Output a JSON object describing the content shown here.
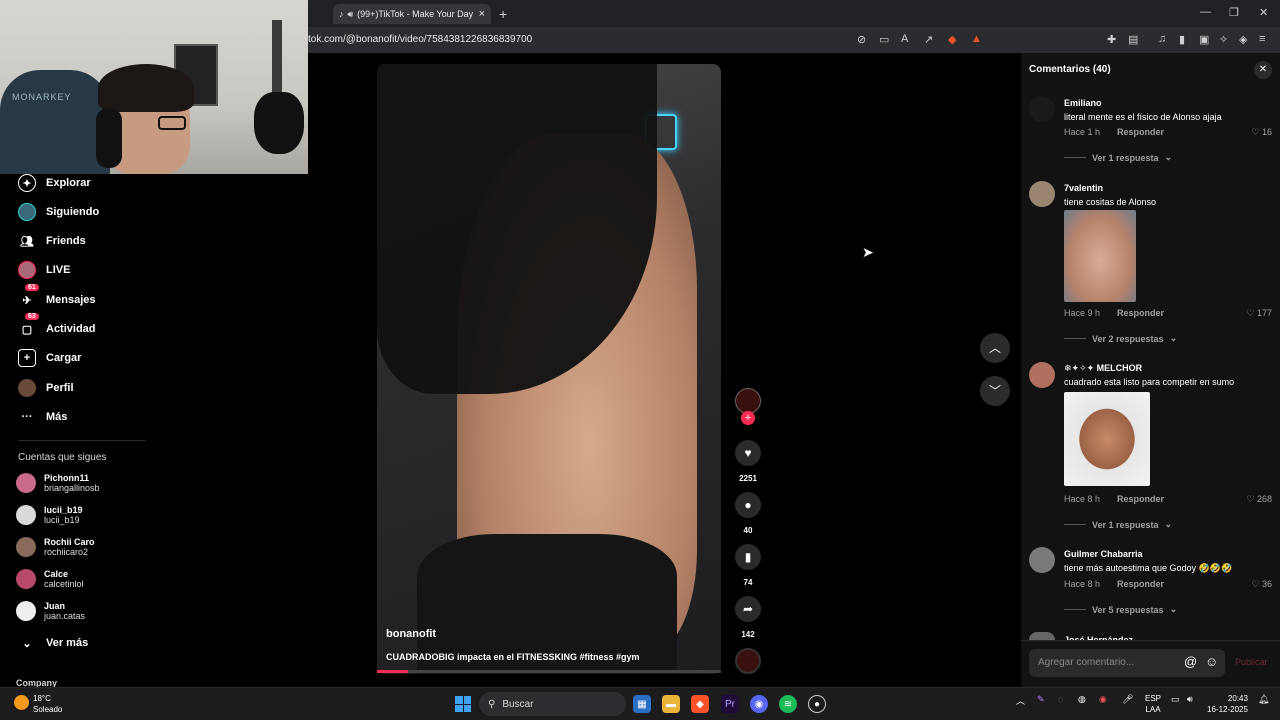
{
  "browser": {
    "tab_title": "(99+)TikTok - Make Your Day",
    "url": "tok.com/@bonanofit/video/7584381226836839700",
    "new_tab": "+",
    "close_tab": "×"
  },
  "webcam": {
    "chair_brand": "MONARKEY"
  },
  "nav": {
    "items": [
      {
        "label": "Explorar",
        "icon": "compass-icon"
      },
      {
        "label": "Siguiendo",
        "icon": "following-avatar-icon"
      },
      {
        "label": "Friends",
        "icon": "friends-icon"
      },
      {
        "label": "LIVE",
        "icon": "live-icon"
      },
      {
        "label": "Mensajes",
        "icon": "messages-icon",
        "badge": "61"
      },
      {
        "label": "Actividad",
        "icon": "activity-icon",
        "badge": "63"
      },
      {
        "label": "Cargar",
        "icon": "upload-icon"
      },
      {
        "label": "Perfil",
        "icon": "profile-icon"
      },
      {
        "label": "Más",
        "icon": "more-icon"
      }
    ],
    "following_title": "Cuentas que sigues",
    "accounts": [
      {
        "name": "Pichonn11",
        "handle": "briangallinosb"
      },
      {
        "name": "lucii_b19",
        "handle": "lucii_b19"
      },
      {
        "name": "Rochii Caro",
        "handle": "rochiicaro2"
      },
      {
        "name": "Calce",
        "handle": "calcetinlol"
      },
      {
        "name": "Juan",
        "handle": "juan.catas"
      }
    ],
    "see_more": "Ver más",
    "company": "Company"
  },
  "video": {
    "username": "bonanofit",
    "caption": "CUADRADOBIG impacta en el FITNESSKING #fitness #gym",
    "progress": 0.09,
    "likes": "2251",
    "comments": "40",
    "saves": "74",
    "shares": "142"
  },
  "comments": {
    "title": "Comentarios (40)",
    "items": [
      {
        "user": "Emiliano",
        "text": "literal mente es el físico de Alonso ajaja",
        "time": "Hace 1 h",
        "reply": "Responder",
        "likes": "16",
        "more": "Ver 1 respuesta"
      },
      {
        "user": "7valentin",
        "text": "tiene cositas de Alonso",
        "time": "Hace 9 h",
        "reply": "Responder",
        "likes": "177",
        "more": "Ver 2 respuestas"
      },
      {
        "user": "MELCHOR",
        "text": "cuadrado esta listo para competir en sumo",
        "time": "Hace 8 h",
        "reply": "Responder",
        "likes": "268",
        "more": "Ver 1 respuesta"
      },
      {
        "user": "Guilmer Chabarria",
        "text": "tiene más autoestima que Godoy 🤣🤣🤣",
        "time": "Hace 8 h",
        "reply": "Responder",
        "likes": "36",
        "more": "Ver 5 respuestas"
      },
      {
        "user": "José Hernández"
      }
    ],
    "input_placeholder": "Agregar comentario...",
    "publish": "Publicar"
  },
  "taskbar": {
    "temperature": "18°C",
    "weather": "Soleado",
    "search": "Buscar",
    "lang1": "ESP",
    "lang2": "LAA",
    "time": "20:43",
    "date": "16-12-2025"
  }
}
